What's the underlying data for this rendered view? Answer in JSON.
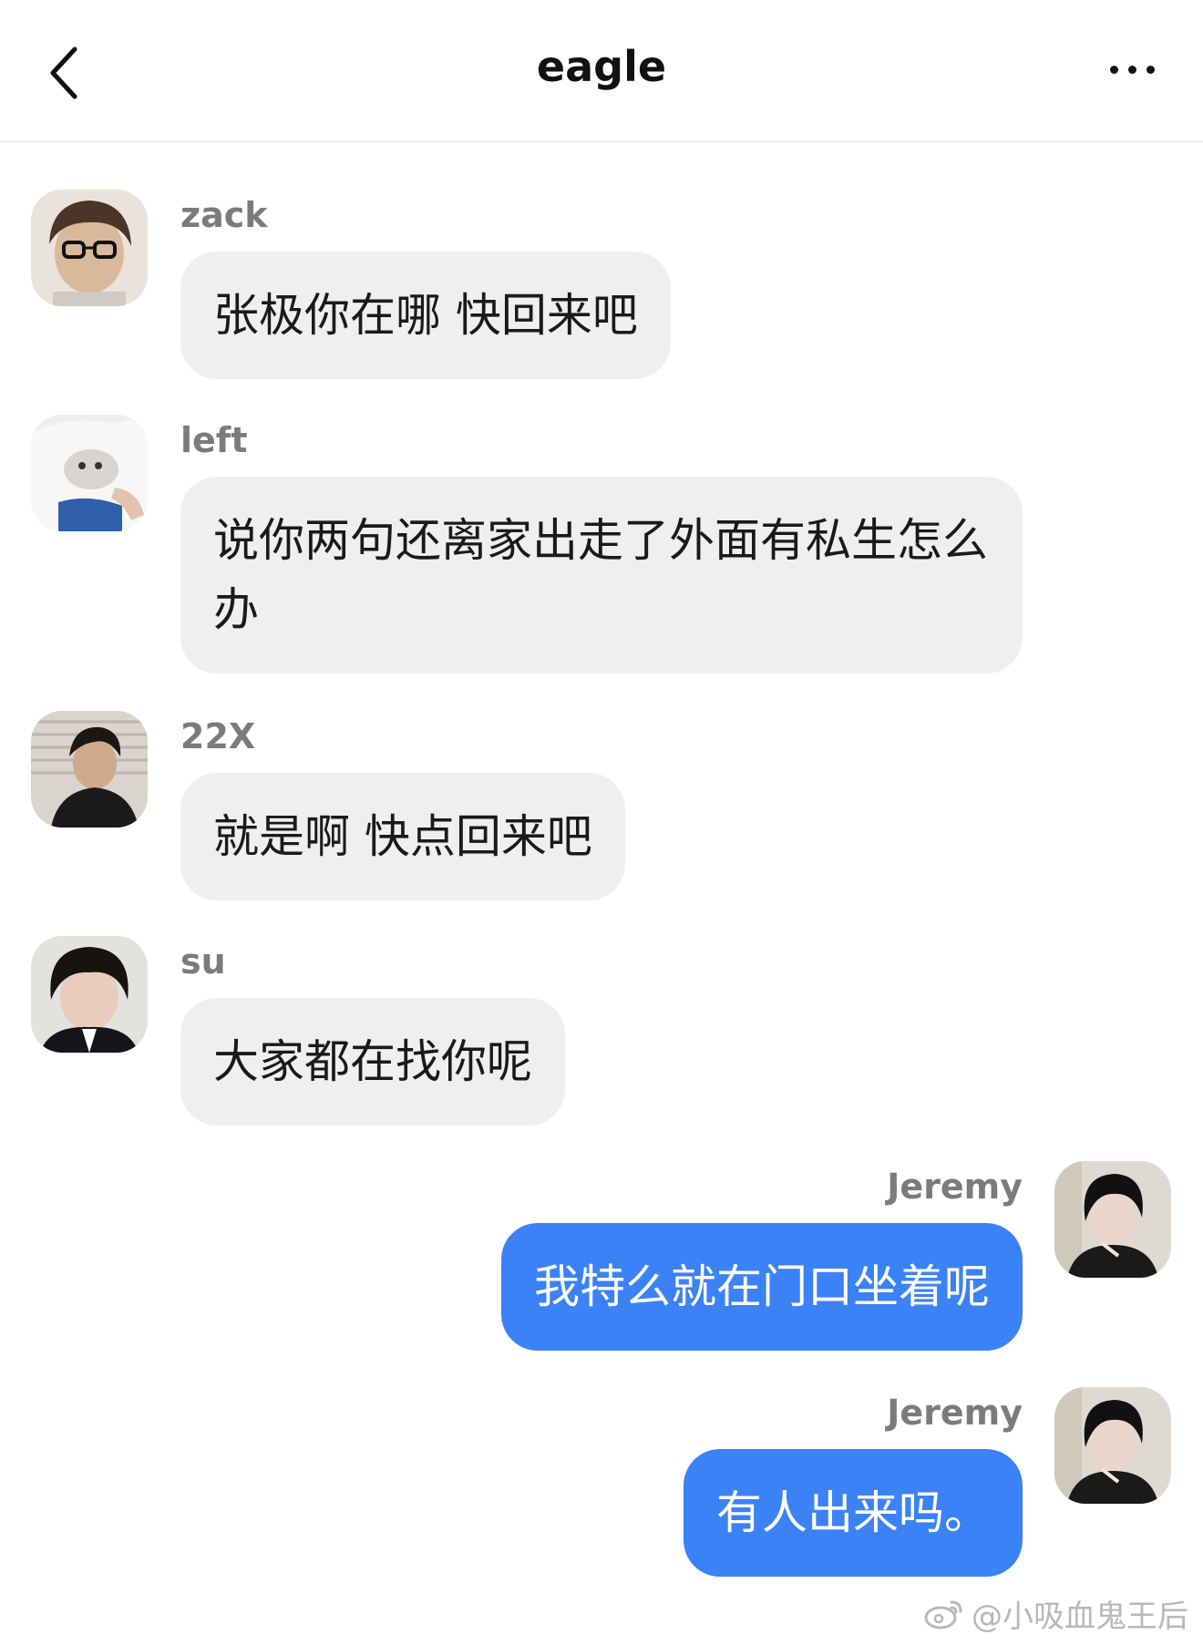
{
  "header": {
    "title": "eagle",
    "back_icon": "chevron-left-icon",
    "more_icon": "more-horizontal-icon"
  },
  "messages": [
    {
      "sender": "zack",
      "text": "张极你在哪 快回来吧",
      "side": "in"
    },
    {
      "sender": "left",
      "text": "说你两句还离家出走了外面有私生怎么办",
      "side": "in"
    },
    {
      "sender": "22X",
      "text": "就是啊 快点回来吧",
      "side": "in"
    },
    {
      "sender": "su",
      "text": "大家都在找你呢",
      "side": "in"
    },
    {
      "sender": "Jeremy",
      "text": "我特么就在门口坐着呢",
      "side": "out"
    },
    {
      "sender": "Jeremy",
      "text": "有人出来吗。",
      "side": "out"
    }
  ],
  "watermark": {
    "text": "@小吸血鬼王后",
    "icon": "weibo-icon"
  },
  "colors": {
    "incoming_bubble": "#efefef",
    "outgoing_bubble": "#3b82f6",
    "sender_name": "#7b7b7b"
  }
}
